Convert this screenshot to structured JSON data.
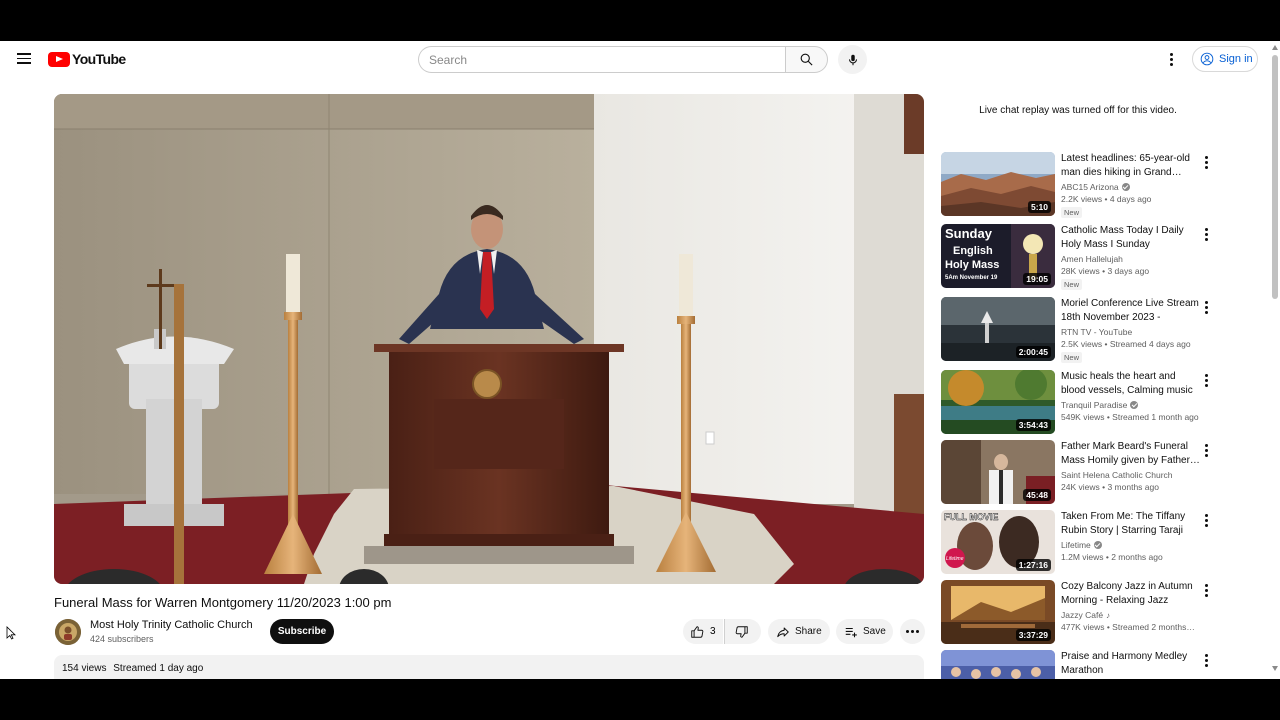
{
  "header": {
    "logo_text": "YouTube",
    "search_placeholder": "Search",
    "signin_label": "Sign in"
  },
  "video": {
    "title": "Funeral Mass for Warren Montgomery 11/20/2023 1:00 pm",
    "channel": "Most Holy Trinity Catholic Church",
    "subscribers": "424 subscribers",
    "subscribe_label": "Subscribe",
    "likes": "3",
    "share_label": "Share",
    "save_label": "Save",
    "views": "154 views",
    "streamed": "Streamed 1 day ago"
  },
  "sidebar": {
    "chat_notice": "Live chat replay was turned off for this video.",
    "items": [
      {
        "title": "Latest headlines: 65-year-old man dies hiking in Grand…",
        "channel": "ABC15 Arizona",
        "verified": true,
        "music": false,
        "views": "2.2K views",
        "age": "4 days ago",
        "badge": "New",
        "duration": "5:10"
      },
      {
        "title": "Catholic Mass Today I Daily Holy Mass I Sunday November…",
        "channel": "Amen Hallelujah",
        "verified": false,
        "music": false,
        "views": "28K views",
        "age": "3 days ago",
        "badge": "New",
        "duration": "19:05",
        "thumb_text": [
          "Sunday",
          "English",
          "Holy Mass",
          "5Am  November 19"
        ]
      },
      {
        "title": "Moriel Conference Live Stream 18th November 2023 - Sessio…",
        "channel": "RTN TV - YouTube",
        "verified": false,
        "music": false,
        "views": "2.5K views",
        "age": "Streamed 4 days ago",
        "badge": "New",
        "duration": "2:00:45"
      },
      {
        "title": "Music heals the heart and blood vessels, Calming music restor…",
        "channel": "Tranquil Paradise",
        "verified": true,
        "music": false,
        "views": "549K views",
        "age": "Streamed 1 month ago",
        "badge": "",
        "duration": "3:54:43"
      },
      {
        "title": "Father Mark Beard's Funeral Mass Homily given by Father…",
        "channel": "Saint Helena Catholic Church",
        "verified": false,
        "music": false,
        "views": "24K views",
        "age": "3 months ago",
        "badge": "",
        "duration": "45:48"
      },
      {
        "title": "Taken From Me: The Tiffany Rubin Story | Starring Taraji P.…",
        "channel": "Lifetime",
        "verified": true,
        "music": false,
        "views": "1.2M views",
        "age": "2 months ago",
        "badge": "",
        "duration": "1:27:16",
        "thumb_text": [
          "FULL MOVIE",
          "Lifetime"
        ]
      },
      {
        "title": "Cozy Balcony Jazz in Autumn Morning - Relaxing Jazz Music…",
        "channel": "Jazzy Café",
        "verified": false,
        "music": true,
        "views": "477K views",
        "age": "Streamed 2 months…",
        "badge": "",
        "duration": "3:37:29"
      },
      {
        "title": "Praise and Harmony Medley Marathon",
        "channel": "",
        "verified": false,
        "music": false,
        "views": "",
        "age": "",
        "badge": "",
        "duration": ""
      }
    ]
  },
  "colors": {
    "brand_red": "#ff0000",
    "link_blue": "#065fd4",
    "text_primary": "#0f0f0f",
    "text_secondary": "#606060",
    "chip_bg": "#f2f2f2"
  }
}
